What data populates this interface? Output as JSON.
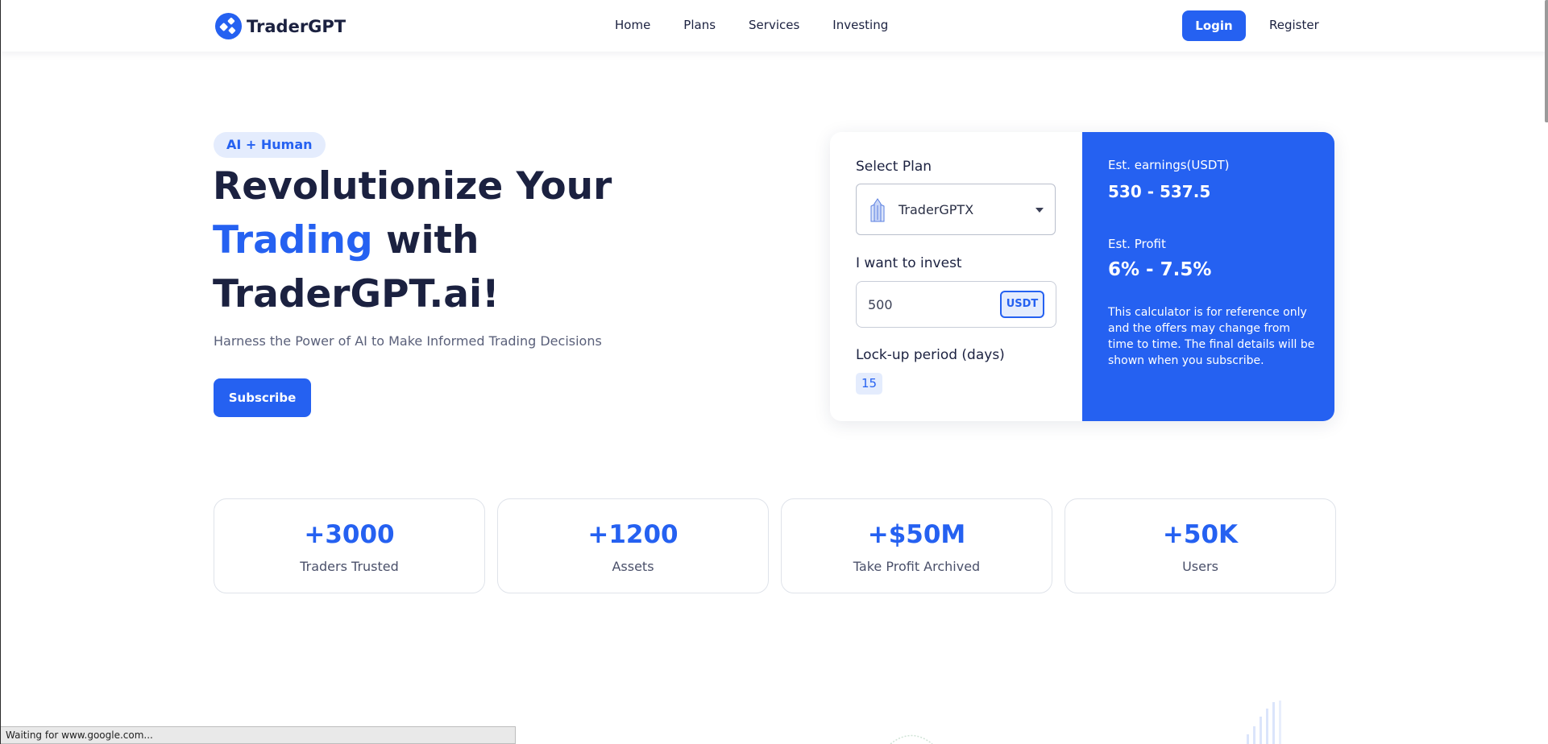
{
  "brand": {
    "name": "TraderGPT",
    "accent_color": "#2561f1",
    "logo_icon": "tradergpt-logo-icon"
  },
  "nav": {
    "items": [
      {
        "label": "Home"
      },
      {
        "label": "Plans"
      },
      {
        "label": "Services"
      },
      {
        "label": "Investing"
      }
    ],
    "login_label": "Login",
    "register_label": "Register"
  },
  "hero": {
    "badge": "AI + Human",
    "title_line1": "Revolutionize Your",
    "title_accent": "Trading",
    "title_line2_rest": " with",
    "title_line3": "TraderGPT.ai!",
    "subtitle": "Harness the Power of AI to Make Informed Trading Decisions",
    "subscribe_label": "Subscribe"
  },
  "calculator": {
    "select_plan_label": "Select Plan",
    "selected_plan": "TraderGPTX",
    "plan_icon": "building-icon",
    "invest_label": "I want to invest",
    "invest_value": "500",
    "currency": "USDT",
    "lockup_label": "Lock-up period (days)",
    "lockup_days": "15",
    "earnings_label": "Est. earnings(USDT)",
    "earnings_value": "530 - 537.5",
    "profit_label": "Est. Profit",
    "profit_value": "6% - 7.5%",
    "note": "This calculator is for reference only and the offers may change from time to time. The final details will be shown when you subscribe."
  },
  "stats": [
    {
      "value": "+3000",
      "label": "Traders Trusted"
    },
    {
      "value": "+1200",
      "label": "Assets"
    },
    {
      "value": "+$50M",
      "label": "Take Profit Archived"
    },
    {
      "value": "+50K",
      "label": "Users"
    }
  ],
  "browser_status": "Waiting for www.google.com..."
}
